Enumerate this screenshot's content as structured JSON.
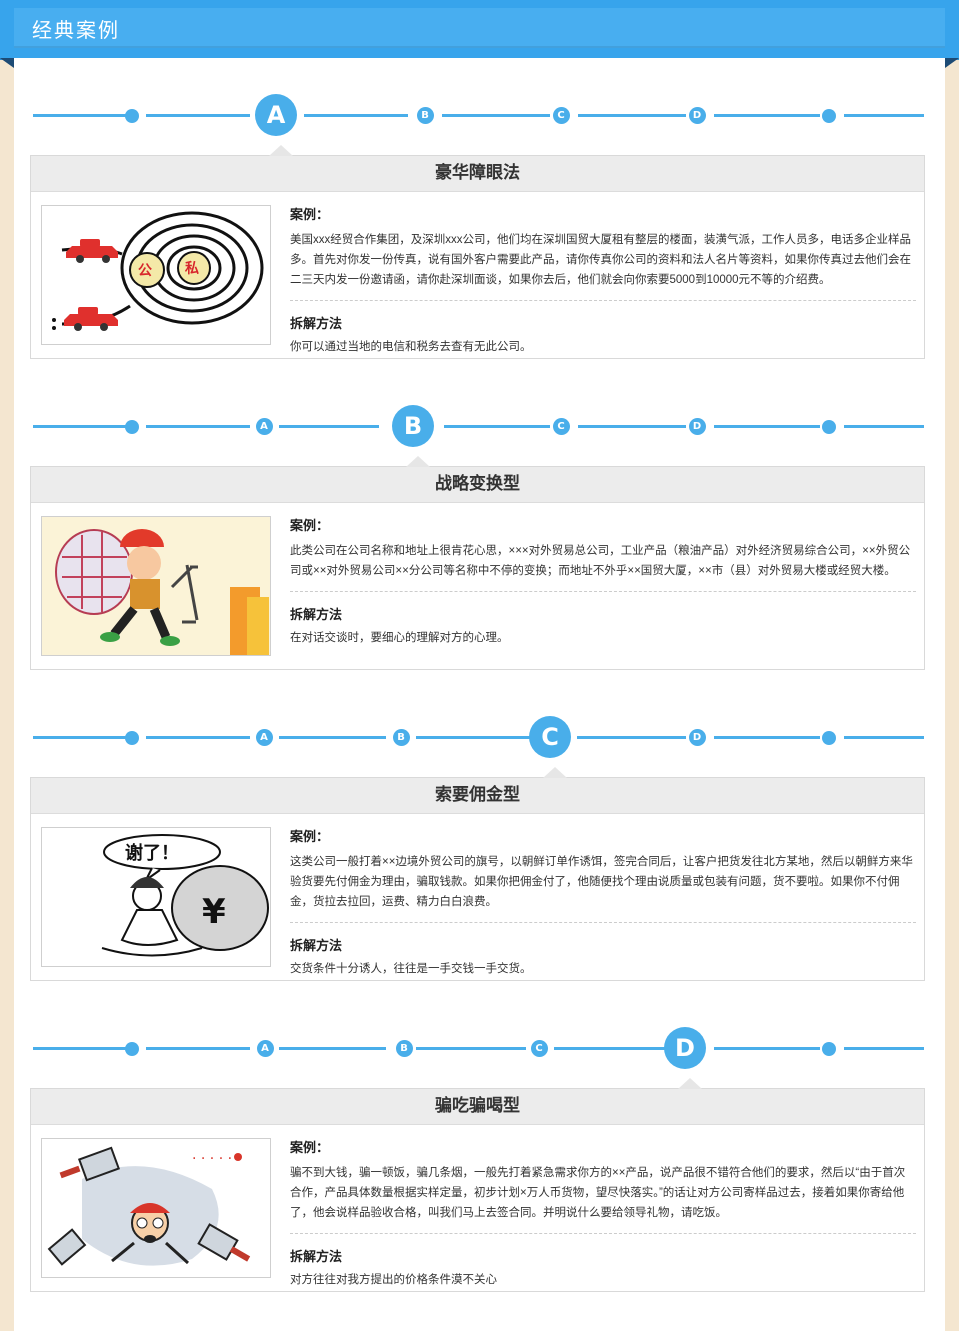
{
  "header": {
    "title": "经典案例"
  },
  "timeline_markers": [
    "A",
    "B",
    "C",
    "D"
  ],
  "cases": [
    {
      "marker": "A",
      "title": "豪华障眼法",
      "case_label": "案例：",
      "case_text": "美国xxx经贸合作集团，及深圳xxx公司，他们均在深圳国贸大厦租有整层的楼面，装潢气派，工作人员多，电话多企业样品多。首先对你发一份传真，说有国外客户需要此产品，请你传真你公司的资料和法人名片等资料，如果你传真过去他们会在二三天内发一份邀请函，请你赴深圳面谈，如果你去后，他们就会向你索要5000到10000元不等的介绍费。",
      "solution_label": "拆解方法",
      "solution_text": "你可以通过当地的电信和税务去查有无此公司。",
      "image_text": [
        "公",
        "私"
      ]
    },
    {
      "marker": "B",
      "title": "战略变换型",
      "case_label": "案例：",
      "case_text": "此类公司在公司名称和地址上很肯花心思，×××对外贸易总公司，工业产品（粮油产品）对外经济贸易综合公司，××外贸公司或××对外贸易公司××分公司等名称中不停的变换；而地址不外乎××国贸大厦，××市（县）对外贸易大楼或经贸大楼。",
      "solution_label": "拆解方法",
      "solution_text": "在对话交谈时，要细心的理解对方的心理。",
      "image_text": []
    },
    {
      "marker": "C",
      "title": "索要佣金型",
      "case_label": "案例：",
      "case_text": "这类公司一般打着××边境外贸公司的旗号，以朝鲜订单作诱饵，签完合同后，让客户把货发往北方某地，然后以朝鲜方来华验货要先付佣金为理由，骗取钱款。如果你把佣金付了，他随便找个理由说质量或包装有问题，货不要啦。如果你不付佣金，货拉去拉回，运费、精力白白浪费。",
      "solution_label": "拆解方法",
      "solution_text": "交货条件十分诱人，往往是一手交钱一手交货。",
      "image_text": [
        "谢了！",
        "¥"
      ]
    },
    {
      "marker": "D",
      "title": "骗吃骗喝型",
      "case_label": "案例：",
      "case_text": "骗不到大钱，骗一顿饭，骗几条烟，一般先打着紧急需求你方的××产品，说产品很不错符合他们的要求，然后以“由于首次合作，产品具体数量根据实样定量，初步计划×万人币货物，望尽快落实。”的话让对方公司寄样品过去，接着如果你寄给他了，他会说样品验收合格，叫我们马上去签合同。并明说什么要给领导礼物，请吃饭。",
      "solution_label": "拆解方法",
      "solution_text": "对方往往对我方提出的价格条件漠不关心",
      "image_text": []
    }
  ]
}
